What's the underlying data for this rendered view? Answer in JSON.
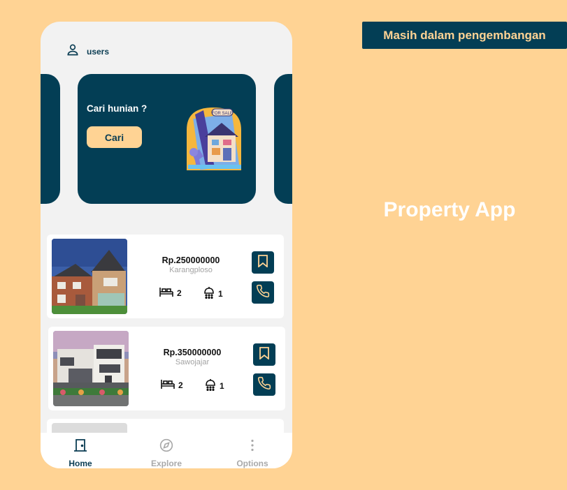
{
  "badge": "Masih dalam pengembangan",
  "app_title": "Property App",
  "header": {
    "user_label": "users"
  },
  "banner": {
    "title": "Cari hunian ?",
    "button_label": "Cari",
    "sticker_text": "FOR SALE"
  },
  "listings": [
    {
      "price": "Rp.250000000",
      "location": "Karangploso",
      "beds": "2",
      "baths": "1"
    },
    {
      "price": "Rp.350000000",
      "location": "Sawojajar",
      "beds": "2",
      "baths": "1"
    }
  ],
  "nav": {
    "home": "Home",
    "explore": "Explore",
    "options": "Options"
  },
  "colors": {
    "background": "#FFD394",
    "primary": "#033E55",
    "accent": "#FFD394",
    "muted": "#A9A9A9"
  }
}
